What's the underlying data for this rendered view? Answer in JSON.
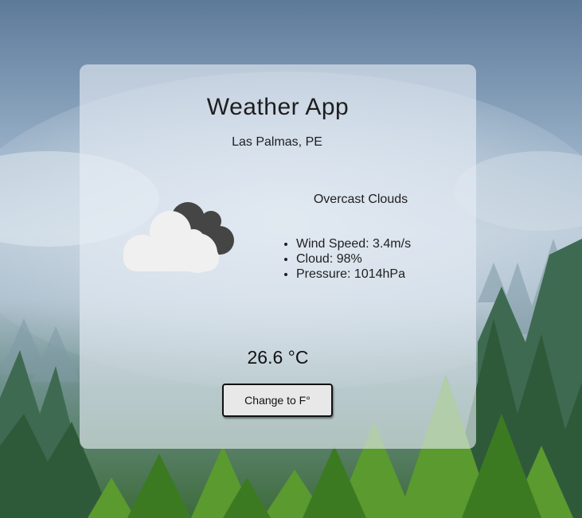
{
  "app": {
    "title": "Weather App",
    "location": "Las Palmas, PE"
  },
  "weather": {
    "condition": "Overcast Clouds",
    "icon": "overcast-clouds-icon",
    "details": [
      "Wind Speed: 3.4m/s",
      "Cloud: 98%",
      "Pressure: 1014hPa"
    ],
    "temperature": "26.6 °C"
  },
  "controls": {
    "unit_toggle_label": "Change to F°"
  },
  "colors": {
    "card_background": "#e6eef6",
    "text": "#1e1e1e",
    "cloud_light": "#f0f0f0",
    "cloud_dark": "#454545",
    "button_background": "#e8e8e8"
  }
}
